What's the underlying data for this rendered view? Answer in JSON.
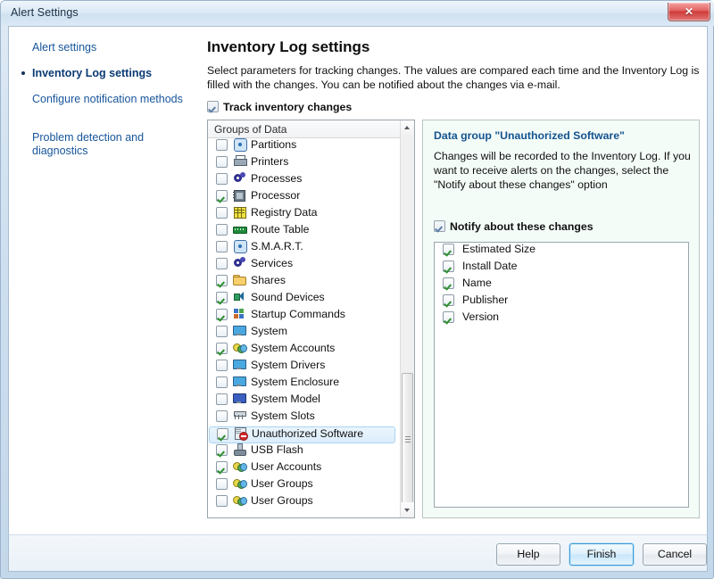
{
  "window": {
    "title": "Alert Settings",
    "close_label": "✕"
  },
  "nav": {
    "items": [
      {
        "label": "Alert settings",
        "active": false
      },
      {
        "label": "Inventory Log settings",
        "active": true
      },
      {
        "label": "Configure notification methods",
        "active": false
      },
      {
        "label": "Problem detection and diagnostics",
        "active": false
      }
    ]
  },
  "main": {
    "title": "Inventory Log settings",
    "description": "Select parameters for tracking changes. The values are compared each time and the Inventory Log is filled with the changes. You can be notified about the changes via e-mail.",
    "track_checkbox": {
      "label": "Track inventory changes",
      "checked": true
    }
  },
  "groups_list": {
    "header": "Groups of Data",
    "items": [
      {
        "label": "Partitions",
        "checked": false,
        "icon": "disk-icon",
        "selected": false
      },
      {
        "label": "Printers",
        "checked": false,
        "icon": "printer-icon",
        "selected": false
      },
      {
        "label": "Processes",
        "checked": false,
        "icon": "gear-icon",
        "selected": false
      },
      {
        "label": "Processor",
        "checked": true,
        "icon": "cpu-icon",
        "selected": false
      },
      {
        "label": "Registry Data",
        "checked": false,
        "icon": "grid-icon",
        "selected": false
      },
      {
        "label": "Route Table",
        "checked": false,
        "icon": "router-icon",
        "selected": false
      },
      {
        "label": "S.M.A.R.T.",
        "checked": false,
        "icon": "disk-icon",
        "selected": false
      },
      {
        "label": "Services",
        "checked": false,
        "icon": "gear-icon",
        "selected": false
      },
      {
        "label": "Shares",
        "checked": true,
        "icon": "folder-icon",
        "selected": false
      },
      {
        "label": "Sound Devices",
        "checked": true,
        "icon": "speaker-icon",
        "selected": false
      },
      {
        "label": "Startup Commands",
        "checked": true,
        "icon": "tiles-icon",
        "selected": false
      },
      {
        "label": "System",
        "checked": false,
        "icon": "monitor-icon",
        "selected": false
      },
      {
        "label": "System Accounts",
        "checked": true,
        "icon": "users-icon",
        "selected": false
      },
      {
        "label": "System Drivers",
        "checked": false,
        "icon": "monitor-icon",
        "selected": false
      },
      {
        "label": "System Enclosure",
        "checked": false,
        "icon": "monitor-icon",
        "selected": false
      },
      {
        "label": "System Model",
        "checked": false,
        "icon": "monitor-dark-icon",
        "selected": false
      },
      {
        "label": "System Slots",
        "checked": false,
        "icon": "slots-icon",
        "selected": false
      },
      {
        "label": "Unauthorized Software",
        "checked": true,
        "icon": "unauthorized-software-icon",
        "selected": true
      },
      {
        "label": "USB Flash",
        "checked": true,
        "icon": "usb-icon",
        "selected": false
      },
      {
        "label": "User Accounts",
        "checked": true,
        "icon": "users-icon",
        "selected": false
      },
      {
        "label": "User Groups",
        "checked": false,
        "icon": "users-icon",
        "selected": false
      },
      {
        "label": "User Groups",
        "checked": false,
        "icon": "users-icon",
        "selected": false
      }
    ]
  },
  "detail": {
    "title": "Data group \"Unauthorized Software\"",
    "description": "Changes will be recorded to the Inventory Log. If you want to receive alerts on the changes, select the \"Notify about these changes\" option",
    "notify_checkbox": {
      "label": "Notify about these changes",
      "checked": true
    },
    "fields": [
      {
        "label": "Estimated Size",
        "checked": true
      },
      {
        "label": "Install Date",
        "checked": true
      },
      {
        "label": "Name",
        "checked": true
      },
      {
        "label": "Publisher",
        "checked": true
      },
      {
        "label": "Version",
        "checked": true
      }
    ]
  },
  "footer": {
    "help_label": "Help",
    "finish_label": "Finish",
    "cancel_label": "Cancel"
  },
  "colors": {
    "link_blue": "#17559c",
    "active_nav": "#0b3b73",
    "detail_title_blue": "#14538f",
    "detail_bg": "#f4fcf8",
    "selection_blue": "#dcedfb",
    "close_red": "#cf3a38"
  }
}
